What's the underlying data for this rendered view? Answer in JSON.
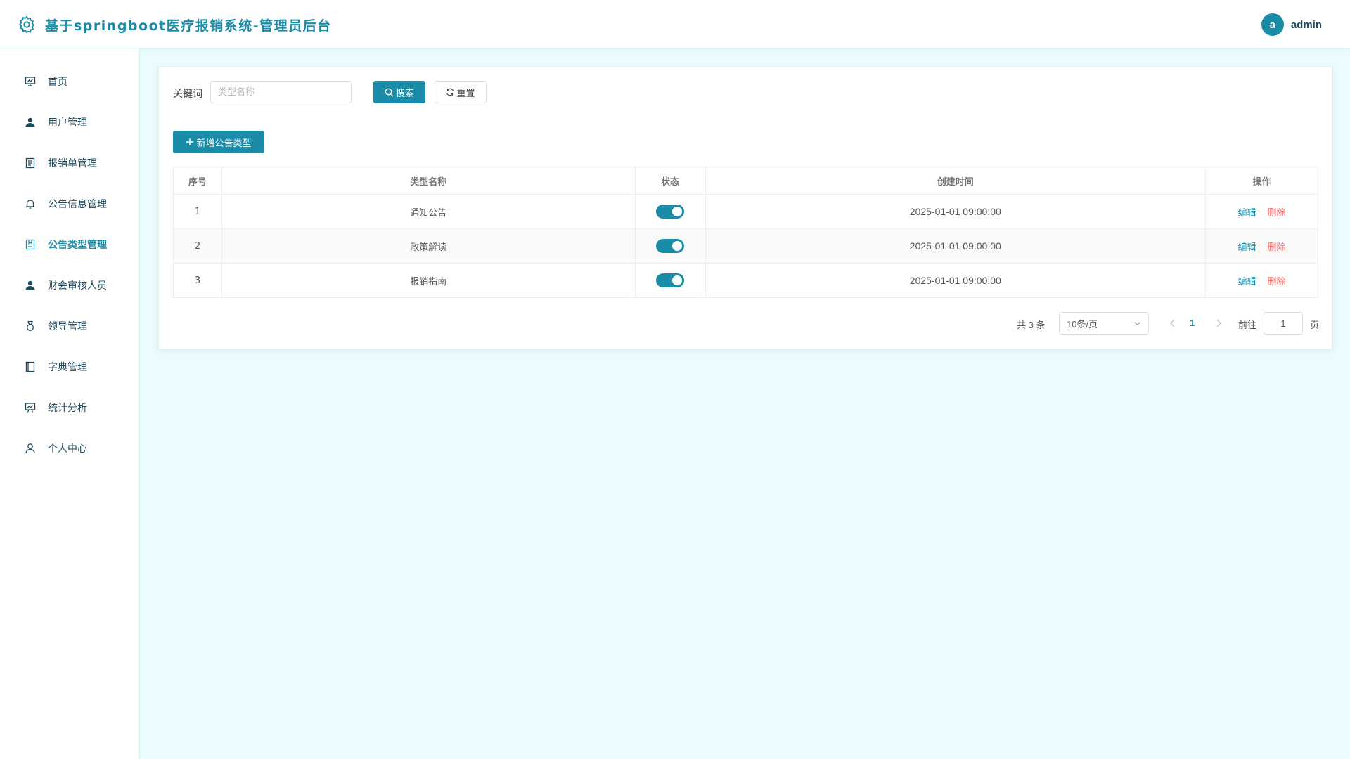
{
  "header": {
    "title": "基于springboot医疗报销系统-管理员后台",
    "avatar_letter": "a",
    "username": "admin"
  },
  "sidebar": {
    "items": [
      {
        "label": "首页",
        "icon": "chart-board-icon"
      },
      {
        "label": "用户管理",
        "icon": "user-icon"
      },
      {
        "label": "报销单管理",
        "icon": "document-icon"
      },
      {
        "label": "公告信息管理",
        "icon": "bell-icon"
      },
      {
        "label": "公告类型管理",
        "icon": "bookmark-icon",
        "active": true
      },
      {
        "label": "财会审核人员",
        "icon": "user-icon"
      },
      {
        "label": "领导管理",
        "icon": "medal-icon"
      },
      {
        "label": "字典管理",
        "icon": "notebook-icon"
      },
      {
        "label": "统计分析",
        "icon": "presentation-icon"
      },
      {
        "label": "个人中心",
        "icon": "user-outline-icon"
      }
    ]
  },
  "search": {
    "keyword_label": "关键词",
    "placeholder": "类型名称",
    "search_label": "搜索",
    "reset_label": "重置"
  },
  "toolbar": {
    "add_label": "新增公告类型"
  },
  "table": {
    "columns": [
      "序号",
      "类型名称",
      "状态",
      "创建时间",
      "操作"
    ],
    "rows": [
      {
        "index": "1",
        "name": "通知公告",
        "enabled": true,
        "created": "2025-01-01 09:00:00"
      },
      {
        "index": "2",
        "name": "政策解读",
        "enabled": true,
        "created": "2025-01-01 09:00:00"
      },
      {
        "index": "3",
        "name": "报销指南",
        "enabled": true,
        "created": "2025-01-01 09:00:00"
      }
    ],
    "edit_label": "编辑",
    "delete_label": "删除"
  },
  "pagination": {
    "total_text": "共 3 条",
    "page_size": "10条/页",
    "current_page": "1",
    "goto_label": "前往",
    "goto_value": "1",
    "page_suffix": "页"
  },
  "colors": {
    "accent": "#1a8ca8",
    "danger": "#f56c6c",
    "background": "#eafcfd"
  }
}
